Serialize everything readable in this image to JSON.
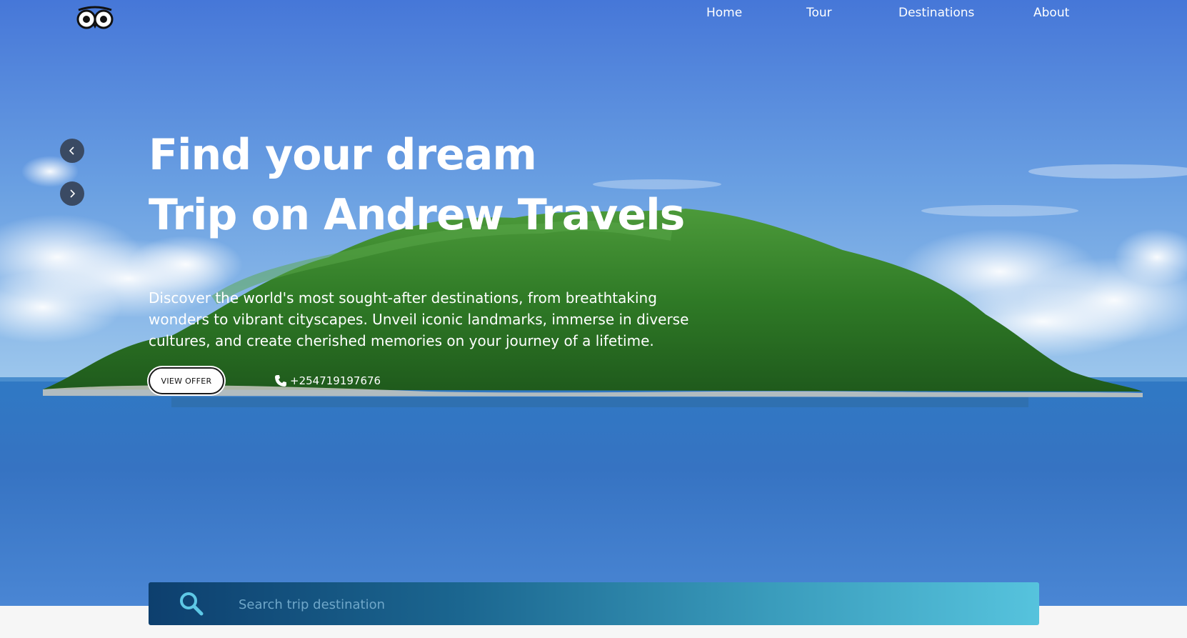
{
  "nav": {
    "items": [
      {
        "label": "Home"
      },
      {
        "label": "Tour"
      },
      {
        "label": "Destinations"
      },
      {
        "label": "About"
      }
    ]
  },
  "hero": {
    "headline_line1": "Find your dream",
    "headline_line2": "Trip on Andrew Travels",
    "description": "Discover the world's most sought-after destinations, from breathtaking wonders to vibrant cityscapes. Unveil iconic landmarks, immerse in diverse cultures, and create cherished memories on your journey of a lifetime.",
    "cta_label": "VIEW OFFER",
    "phone": "+254719197676"
  },
  "carousel": {
    "prev_icon": "chevron-left-icon",
    "next_icon": "chevron-right-icon"
  },
  "search": {
    "placeholder": "Search trip destination",
    "value": "",
    "icon": "search-icon"
  },
  "colors": {
    "sky": "#4f7fd9",
    "sea": "#3772c4",
    "search_start": "#0d3f6e",
    "search_end": "#56c3dd",
    "search_icon": "#5ec8e6",
    "arrow_bg": "#3a4a63"
  }
}
